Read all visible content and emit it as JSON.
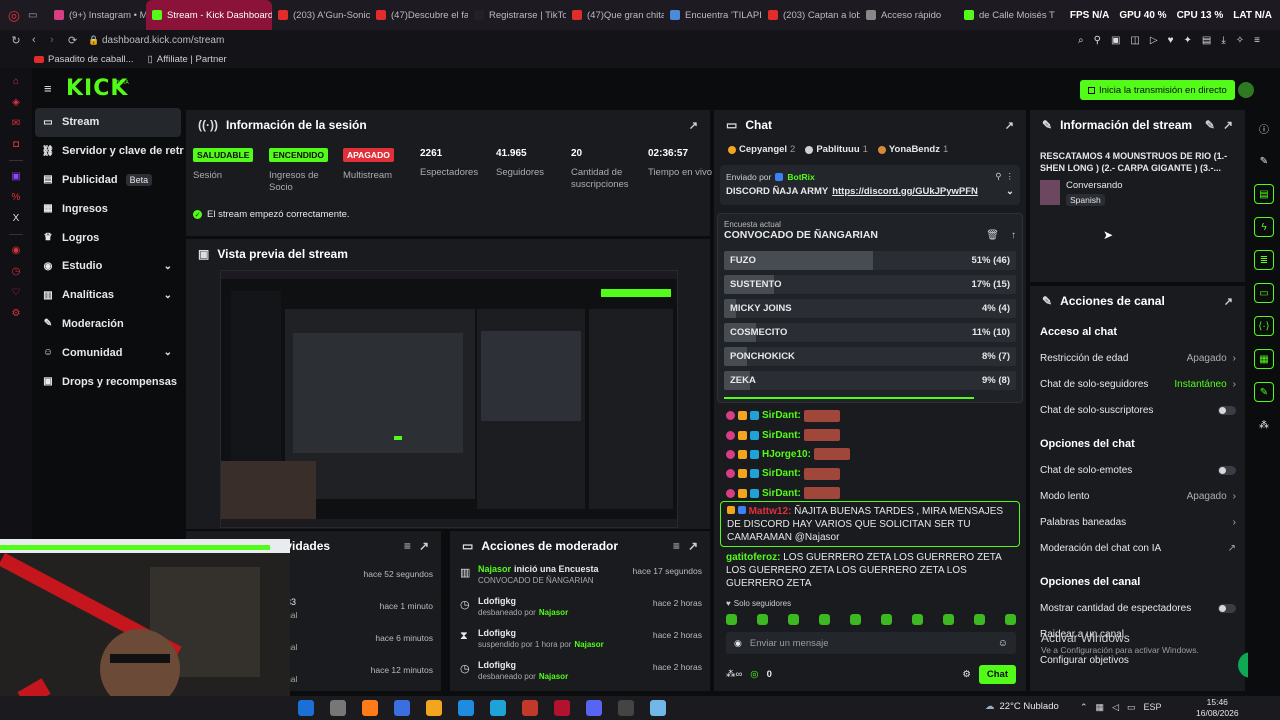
{
  "browser": {
    "tabs": [
      {
        "label": "(9+) Instagram • M",
        "color": "#d93d84"
      },
      {
        "label": "Stream - Kick Dashboard",
        "color": "#53fc18",
        "active": true
      },
      {
        "label": "(203) A'Gun-Sonic",
        "color": "#e22b2b"
      },
      {
        "label": "(47)Descubre el fa",
        "color": "#e22b2b"
      },
      {
        "label": "Registrarse | TikTo",
        "color": "#222"
      },
      {
        "label": "(47)Que gran chita",
        "color": "#e22b2b"
      },
      {
        "label": "Encuentra 'TILAPIA",
        "color": "#4a8bd8"
      },
      {
        "label": "(203) Captan a lob",
        "color": "#e22b2b"
      },
      {
        "label": "Acceso rápido",
        "color": "#888"
      },
      {
        "label": "de Calle Moisés T",
        "color": "#53fc18"
      }
    ],
    "hud": {
      "fps_label": "FPS",
      "fps": "N/A",
      "gpu_label": "GPU",
      "gpu": "40 %",
      "cpu_label": "CPU",
      "cpu": "13 %",
      "lat_label": "LAT",
      "lat": "N/A"
    },
    "url": "dashboard.kick.com/stream",
    "bookmarks": [
      "Pasadito de caball...",
      "Affiliate | Partner"
    ]
  },
  "header": {
    "logo": "KICK",
    "live_button": "Inicia la transmisión en directo"
  },
  "sidebar": {
    "items": [
      {
        "label": "Stream",
        "icon": "video-icon",
        "glyph": "▭"
      },
      {
        "label": "Servidor y clave de retran",
        "icon": "link-icon",
        "glyph": "⛓"
      },
      {
        "label": "Publicidad",
        "icon": "ad-icon",
        "glyph": "▤",
        "badge": "Beta"
      },
      {
        "label": "Ingresos",
        "icon": "money-icon",
        "glyph": "▦"
      },
      {
        "label": "Logros",
        "icon": "trophy-icon",
        "glyph": "♛"
      },
      {
        "label": "Estudio",
        "icon": "studio-icon",
        "glyph": "◉",
        "chevron": true
      },
      {
        "label": "Analíticas",
        "icon": "chart-icon",
        "glyph": "▥",
        "chevron": true
      },
      {
        "label": "Moderación",
        "icon": "wrench-icon",
        "glyph": "✎"
      },
      {
        "label": "Comunidad",
        "icon": "people-icon",
        "glyph": "☺",
        "chevron": true
      },
      {
        "label": "Drops y recompensas",
        "icon": "gift-icon",
        "glyph": "▣"
      }
    ]
  },
  "session": {
    "title": "Información de la sesión",
    "stats": [
      {
        "value": "SALUDABLE",
        "label": "Sesión",
        "pill": "#53fc18"
      },
      {
        "value": "ENCENDIDO",
        "label": "Ingresos de Socio",
        "pill": "#53fc18"
      },
      {
        "value": "APAGADO",
        "label": "Multistream",
        "pill": "#e0313b"
      },
      {
        "value": "2261",
        "label": "Espectadores"
      },
      {
        "value": "41.965",
        "label": "Seguidores"
      },
      {
        "value": "20",
        "label": "Cantidad de suscripciones"
      },
      {
        "value": "02:36:57",
        "label": "Tiempo en vivo"
      }
    ],
    "status_msg": "El stream empezó correctamente."
  },
  "preview": {
    "title": "Vista previa del stream"
  },
  "feed": {
    "title": "Feed de actividades",
    "rows": [
      {
        "num": "",
        "sub": "",
        "time": "hace 52 segundos"
      },
      {
        "num": "33",
        "sub": "nal",
        "time": "hace 1 minuto"
      },
      {
        "num": "",
        "sub": "nal",
        "time": "hace 6 minutos"
      },
      {
        "num": "",
        "sub": "nal",
        "time": "hace 12 minutos"
      }
    ]
  },
  "modactions": {
    "title": "Acciones de moderador",
    "rows": [
      {
        "icon": "poll-icon",
        "glyph": "▥",
        "user": "Najasor",
        "action": "inició una Encuesta",
        "detail": "CONVOCADO DE ÑANGARIAN",
        "time": "hace 17 segundos"
      },
      {
        "icon": "clock-icon",
        "glyph": "◷",
        "user": "Ldofigkg",
        "action": "",
        "detail": "desbaneado por",
        "by": "Najasor",
        "time": "hace 2 horas"
      },
      {
        "icon": "hourglass-icon",
        "glyph": "⧗",
        "user": "Ldofigkg",
        "action": "",
        "detail": "suspendido por 1 hora por",
        "by": "Najasor",
        "time": "hace 2 horas"
      },
      {
        "icon": "clock-icon",
        "glyph": "◷",
        "user": "Ldofigkg",
        "action": "",
        "detail": "desbaneado por",
        "by": "Najasor",
        "time": "hace 2 horas"
      }
    ]
  },
  "chat": {
    "title": "Chat",
    "top_users": [
      {
        "name": "Cepyangel",
        "n": "2"
      },
      {
        "name": "Pablituuu",
        "n": "1"
      },
      {
        "name": "YonaBendz",
        "n": "1"
      }
    ],
    "pinned_label": "Enviado por",
    "pinned_by": "BotRix",
    "pinned_text": "DISCORD ÑAJA ARMY",
    "pinned_link": "https://discord.gg/GUkJPywPFN",
    "poll_label": "Encuesta actual",
    "poll_title": "CONVOCADO DE ÑANGARIAN",
    "poll": [
      {
        "name": "FUZO",
        "pct": "51% (46)",
        "frac": 0.51
      },
      {
        "name": "SUSTENTO",
        "pct": "17% (15)",
        "frac": 0.17
      },
      {
        "name": "MICKY JOINS",
        "pct": "4% (4)",
        "frac": 0.04
      },
      {
        "name": "COSMECITO",
        "pct": "11% (10)",
        "frac": 0.11
      },
      {
        "name": "PONCHOKICK",
        "pct": "8% (7)",
        "frac": 0.08
      },
      {
        "name": "ZEKA",
        "pct": "9% (8)",
        "frac": 0.09
      }
    ],
    "messages": [
      {
        "user": "SirDant:",
        "color": "#53fc18"
      },
      {
        "user": "SirDant:",
        "color": "#53fc18"
      },
      {
        "user": "HJorge10:",
        "color": "#53fc18"
      },
      {
        "user": "SirDant:",
        "color": "#53fc18"
      },
      {
        "user": "SirDant:",
        "color": "#53fc18"
      }
    ],
    "highlight_user": "Mattw12:",
    "highlight_text": "ÑAJITA BUENAS TARDES , MIRA MENSAJES DE DISCORD HAY VARIOS QUE SOLICITAN SER TU CAMARAMAN @Najasor",
    "gati_user": "gatitoferoz:",
    "gati_text": "LOS GUERRERO ZETA   LOS GUERRERO ZETA   LOS GUERRERO ZETA   LOS GUERRERO ZETA   LOS GUERRERO ZETA",
    "followers_only": "Solo seguidores",
    "input_placeholder": "Enviar un mensaje",
    "points": "0",
    "send_button": "Chat"
  },
  "streaminfo": {
    "title": "Información del stream",
    "stream_title": "RESCATAMOS 4 MOUNSTRUOS DE RIO (1.- SHEN LONG ) (2.- CARPA GIGANTE ) (3.-...",
    "category": "Conversando",
    "language": "Spanish"
  },
  "channel": {
    "title": "Acciones de canal",
    "sections": [
      {
        "heading": "Acceso al chat",
        "rows": [
          {
            "label": "Restricción de edad",
            "value": "Apagado",
            "kind": "chev"
          },
          {
            "label": "Chat de solo-seguidores",
            "value": "Instantáneo",
            "kind": "chev",
            "green": true
          },
          {
            "label": "Chat de solo-suscriptores",
            "value": "",
            "kind": "toggle"
          }
        ]
      },
      {
        "heading": "Opciones del chat",
        "rows": [
          {
            "label": "Chat de solo-emotes",
            "value": "",
            "kind": "toggle"
          },
          {
            "label": "Modo lento",
            "value": "Apagado",
            "kind": "chev"
          },
          {
            "label": "Palabras baneadas",
            "value": "",
            "kind": "chev"
          },
          {
            "label": "Moderación del chat con IA",
            "value": "",
            "kind": "ext"
          }
        ]
      },
      {
        "heading": "Opciones del canal",
        "rows": [
          {
            "label": "Mostrar cantidad de espectadores",
            "value": "",
            "kind": "toggle"
          },
          {
            "label": "Raidear a un canal",
            "value": "",
            "kind": "none"
          },
          {
            "label": "Configurar objetivos",
            "value": "",
            "kind": "none"
          }
        ]
      }
    ],
    "watermark_title": "Activar Windows",
    "watermark_sub": "Ve a Configuración para activar Windows."
  },
  "taskbar": {
    "weather": "22°C  Nublado",
    "lang": "ESP",
    "time": "15:46",
    "date": "16/08/2026",
    "apps": [
      "#1b6fd6",
      "#777",
      "#ff7b1a",
      "#3b6fe0",
      "#f2a61d",
      "#1f8ce0",
      "#1fa2d6",
      "#c0392b",
      "#b3122e",
      "#5865f2",
      "#444",
      "#6fb8e8"
    ]
  }
}
